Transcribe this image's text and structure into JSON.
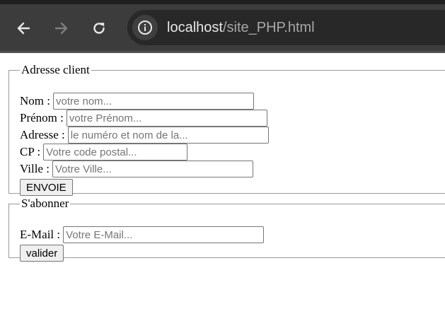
{
  "browser": {
    "url_host": "localhost",
    "url_path": "/site_PHP.html",
    "icons": {
      "back": "back-arrow-icon",
      "forward": "forward-arrow-icon",
      "reload": "reload-icon",
      "info": "info-icon"
    }
  },
  "client_form": {
    "legend": "Adresse client",
    "fields": [
      {
        "label": "Nom :",
        "placeholder": "votre nom..."
      },
      {
        "label": "Prénom :",
        "placeholder": "votre Prénom..."
      },
      {
        "label": "Adresse :",
        "placeholder": "le numéro et nom de la..."
      },
      {
        "label": "CP :",
        "placeholder": "Votre code postal..."
      },
      {
        "label": "Ville :",
        "placeholder": "Votre Ville..."
      }
    ],
    "submit_label": "ENVOIE"
  },
  "subscribe_form": {
    "legend": "S'abonner",
    "email_label": "E-Mail :",
    "email_placeholder": "Votre E-Mail...",
    "submit_label": "valider"
  }
}
